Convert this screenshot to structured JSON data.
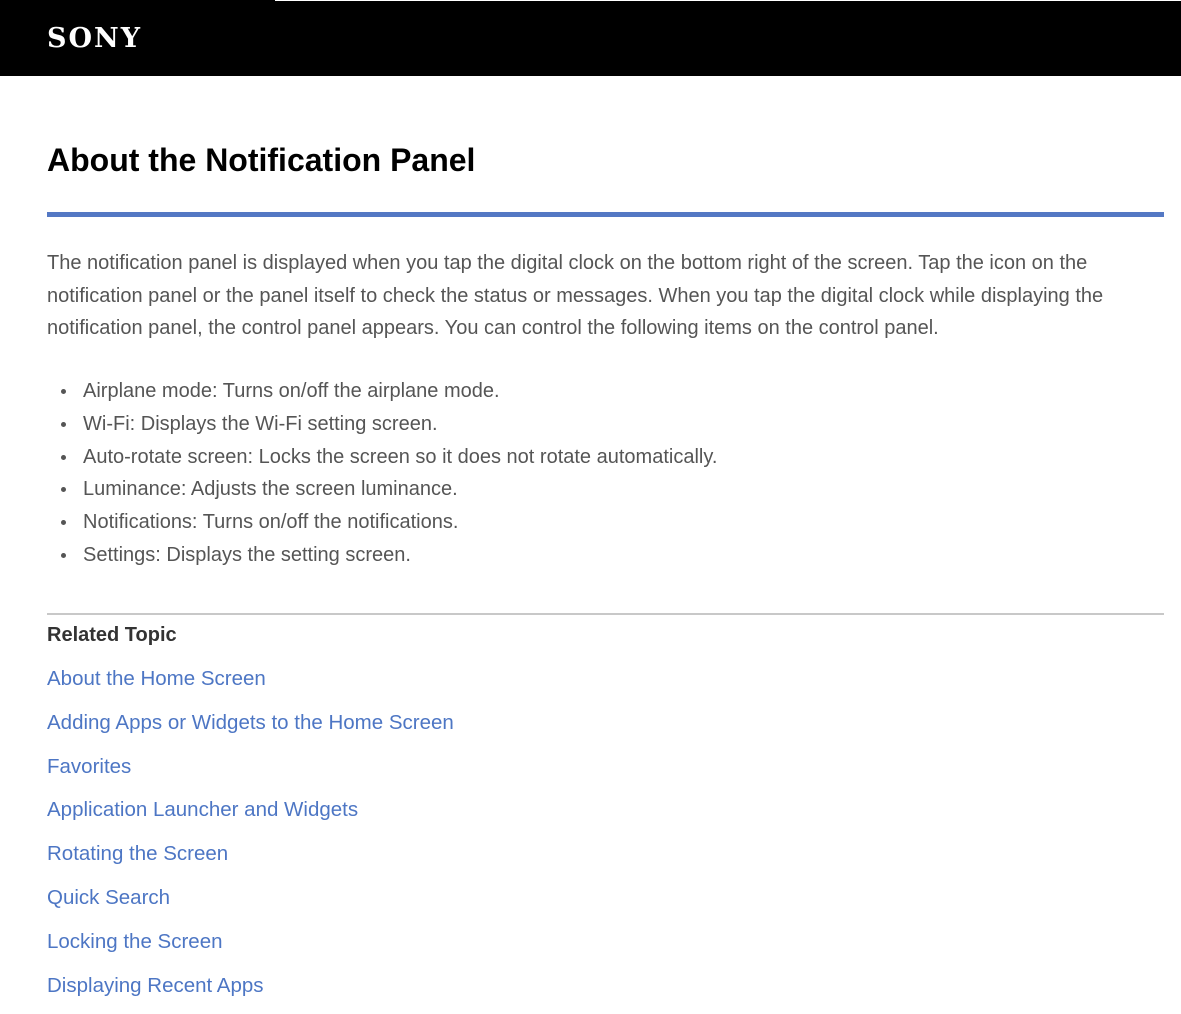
{
  "header": {
    "logo_text": "SONY",
    "background_color": "#000000"
  },
  "page": {
    "title": "About the Notification Panel",
    "accent_color": "#5478c4",
    "intro": "The notification panel is displayed when you tap the digital clock on the bottom right of the screen. Tap the icon on the notification panel or the panel itself to check the status or messages. When you tap the digital clock while displaying the notification panel, the control panel appears. You can control the following items on the control panel.",
    "items": [
      "Airplane mode: Turns on/off the airplane mode.",
      "Wi-Fi: Displays the Wi-Fi setting screen.",
      "Auto-rotate screen: Locks the screen so it does not rotate automatically.",
      "Luminance: Adjusts the screen luminance.",
      "Notifications: Turns on/off the notifications.",
      "Settings: Displays the setting screen."
    ]
  },
  "related": {
    "heading": "Related Topic",
    "link_color": "#4d76c4",
    "links": [
      "About the Home Screen",
      "Adding Apps or Widgets to the Home Screen",
      "Favorites",
      "Application Launcher and Widgets",
      "Rotating the Screen",
      "Quick Search",
      "Locking the Screen",
      "Displaying Recent Apps"
    ]
  }
}
